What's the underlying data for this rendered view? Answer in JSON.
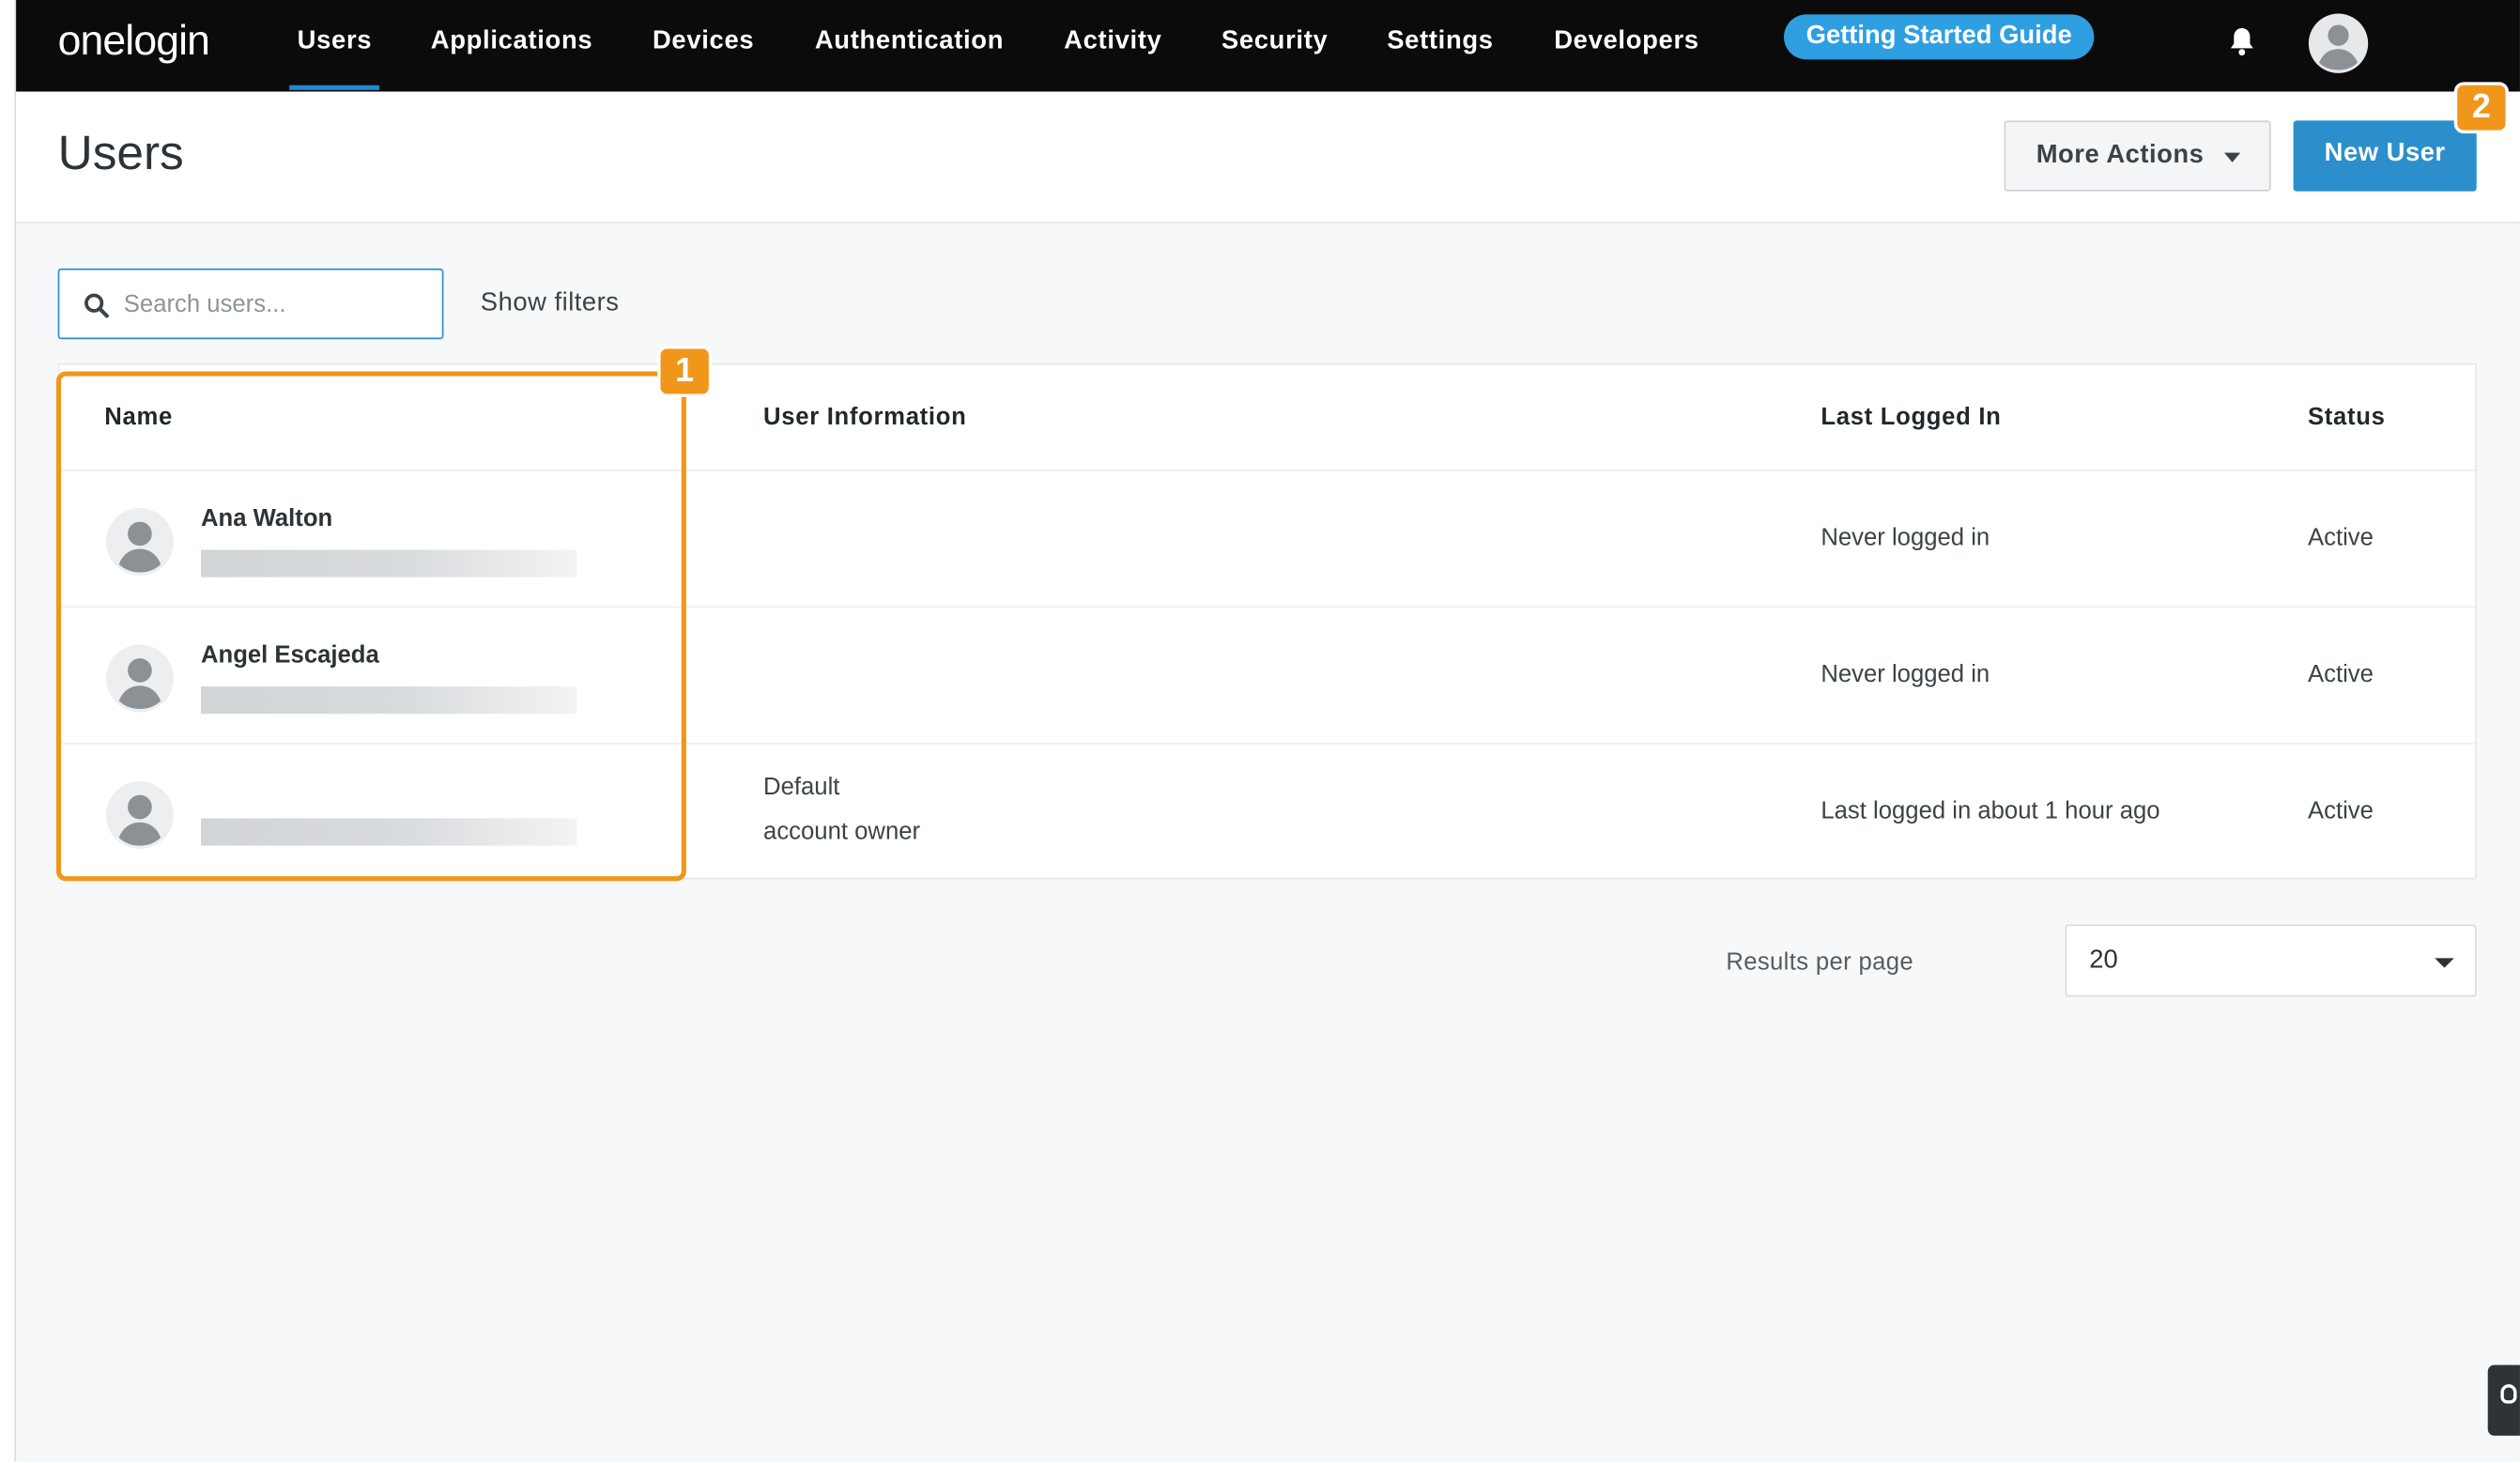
{
  "app": {
    "logo": "onelogin"
  },
  "nav": {
    "items": [
      "Users",
      "Applications",
      "Devices",
      "Authentication",
      "Activity",
      "Security",
      "Settings",
      "Developers"
    ],
    "active": "Users",
    "guide_label": "Getting Started Guide",
    "icons": {
      "notifications": "bell-icon",
      "profile": "user-avatar-icon"
    }
  },
  "header": {
    "title": "Users",
    "more_actions_label": "More Actions",
    "new_user_label": "New User"
  },
  "toolbar": {
    "search_placeholder": "Search users...",
    "show_filters_label": "Show filters"
  },
  "table": {
    "columns": [
      "Name",
      "User Information",
      "Last Logged In",
      "Status"
    ],
    "rows": [
      {
        "name": "Ana Walton",
        "info": [
          "",
          ""
        ],
        "last_logged_in": "Never logged in",
        "status": "Active"
      },
      {
        "name": "Angel Escajeda",
        "info": [
          "",
          ""
        ],
        "last_logged_in": "Never logged in",
        "status": "Active"
      },
      {
        "name": "",
        "info": [
          "Default",
          "account owner"
        ],
        "last_logged_in": "Last logged in about 1 hour ago",
        "status": "Active"
      }
    ]
  },
  "pagination": {
    "results_per_page_label": "Results per page",
    "results_per_page_value": "20"
  },
  "callouts": {
    "first": "1",
    "second": "2"
  },
  "colors": {
    "accent": "#2c8fcc",
    "guide": "#2e9fe0",
    "callout": "#f0961b",
    "topbar": "#0b0b0c"
  }
}
